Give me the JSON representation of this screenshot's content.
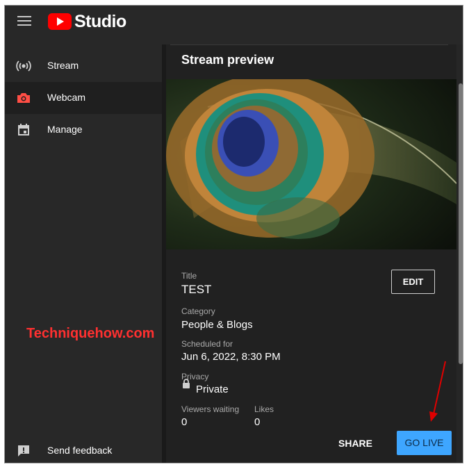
{
  "app": {
    "logo_text": "Studio"
  },
  "sidebar": {
    "items": [
      {
        "label": "Stream",
        "icon": "stream-broadcast-icon"
      },
      {
        "label": "Webcam",
        "icon": "camera-icon",
        "active": true,
        "accent": "#ff4e45"
      },
      {
        "label": "Manage",
        "icon": "calendar-icon"
      }
    ],
    "feedback_label": "Send feedback"
  },
  "overlay": {
    "watermark": "Techniquehow.com",
    "watermark_color": "#ff3030",
    "arrow_color": "#e00000"
  },
  "panel": {
    "title": "Stream preview",
    "title_label": "Title",
    "title_value": "TEST",
    "edit_label": "EDIT",
    "category_label": "Category",
    "category_value": "People & Blogs",
    "scheduled_label": "Scheduled for",
    "scheduled_value": "Jun 6, 2022, 8:30 PM",
    "privacy_label": "Privacy",
    "privacy_value": "Private",
    "viewers_label": "Viewers waiting",
    "viewers_value": "0",
    "likes_label": "Likes",
    "likes_value": "0",
    "share_label": "SHARE",
    "go_live_label": "GO LIVE",
    "go_live_color": "#3ea6ff"
  }
}
